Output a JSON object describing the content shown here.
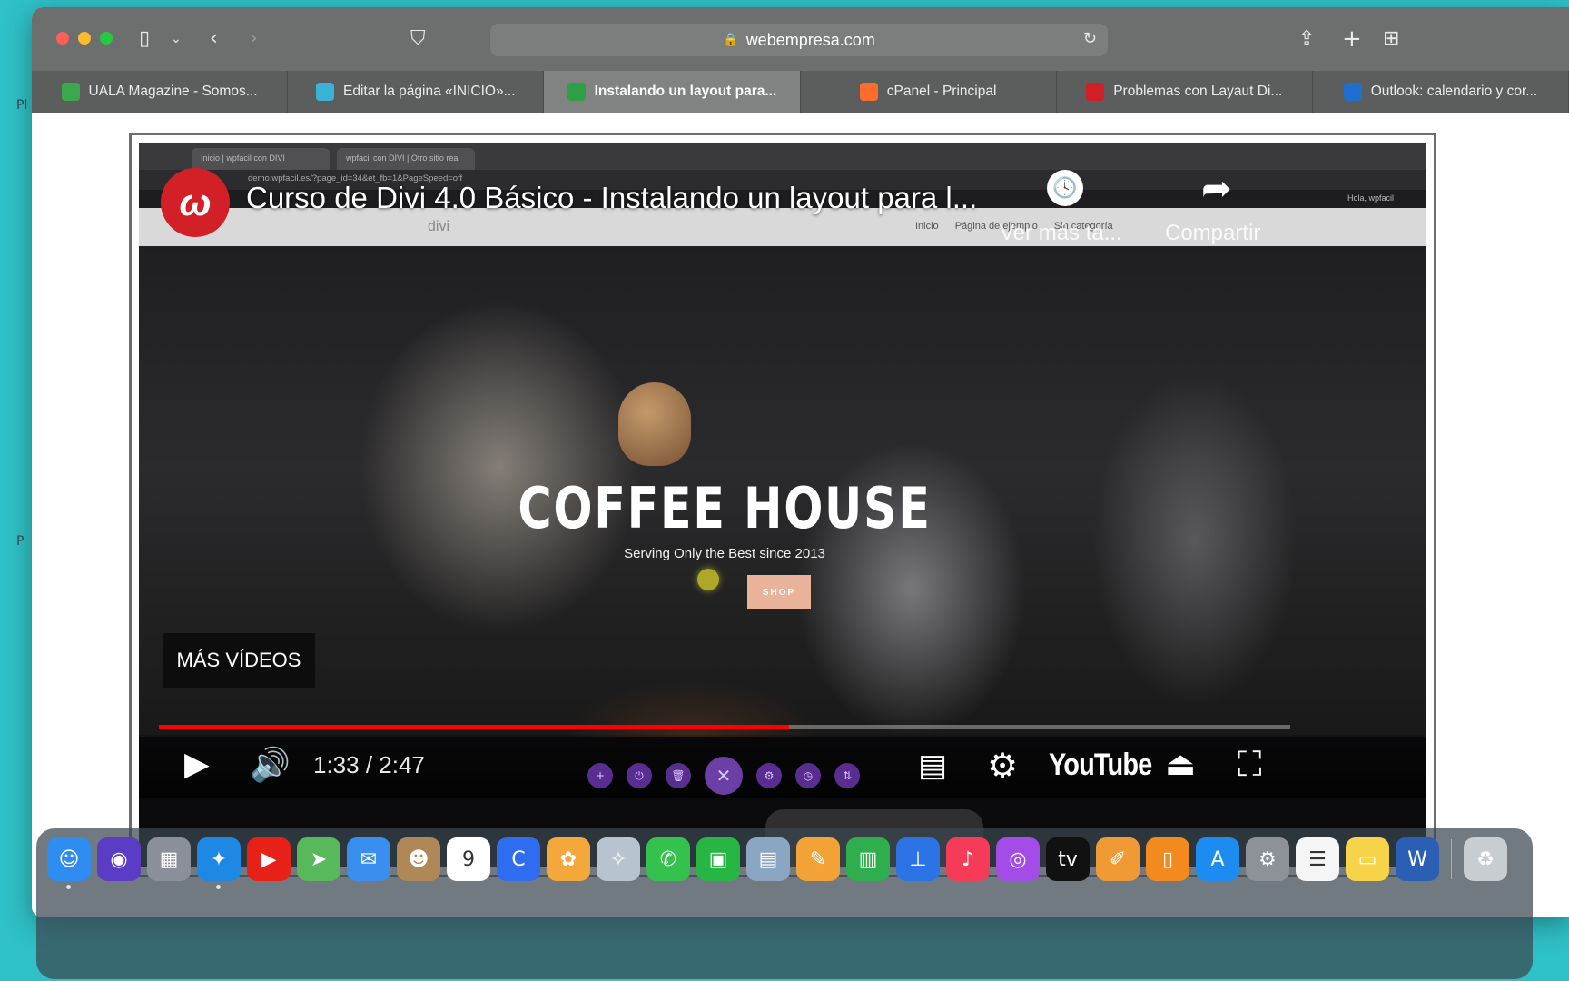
{
  "desktop": {
    "left_text_1": "Pl",
    "left_text_2": "P"
  },
  "browser": {
    "url": "webempresa.com",
    "tabs": [
      {
        "label": "UALA Magazine - Somos...",
        "icon": "uala-favicon",
        "color": "#3aa84b",
        "active": false
      },
      {
        "label": "Editar la página «INICIO»...",
        "icon": "divi-edit-favicon",
        "color": "#3bb3d6",
        "active": false
      },
      {
        "label": "Instalando un layout para...",
        "icon": "webempresa-favicon",
        "color": "#2e9f45",
        "active": true
      },
      {
        "label": "cPanel - Principal",
        "icon": "cpanel-favicon",
        "color": "#ff6c2c",
        "active": false
      },
      {
        "label": "Problemas con Layaut Di...",
        "icon": "webempresa-red-favicon",
        "color": "#d31f26",
        "active": false
      },
      {
        "label": "Outlook: calendario y cor...",
        "icon": "outlook-favicon",
        "color": "#1f6fd1",
        "active": false
      }
    ]
  },
  "recorded_browser": {
    "tab1": "Inicio | wpfacil con DIVI",
    "tab2": "wpfacil con DIVI | Otro sitio real",
    "url": "demo.wpfacil.es/?page_id=34&et_fb=1&PageSpeed=off",
    "admin_user": "Hola, wpfacil",
    "site_logo": "divi",
    "nav": [
      "Inicio",
      "Página de ejemplo",
      "Sin categoría"
    ]
  },
  "hero": {
    "title": "COFFEE HOUSE",
    "subtitle": "Serving Only the Best since 2013",
    "button": "SHOP"
  },
  "youtube": {
    "video_title": "Curso de Divi 4.0 Básico - Instalando un layout para l...",
    "channel": "webempresa",
    "watch_later_label": "Ver más ta...",
    "share_label": "Compartir",
    "more_videos": "MÁS VÍDEOS",
    "current_time": "1:33",
    "duration": "2:47",
    "time_display": "1:33 / 2:47",
    "progress_fraction": 0.557,
    "logo": "YouTube"
  },
  "dock": [
    {
      "name": "finder-icon",
      "glyph": "☺",
      "color": "#2f8cf0",
      "running": true
    },
    {
      "name": "siri-icon",
      "glyph": "◉",
      "color": "#5b3cc4",
      "running": false
    },
    {
      "name": "launchpad-icon",
      "glyph": "▦",
      "color": "#8a8f99",
      "running": false
    },
    {
      "name": "safari-icon",
      "glyph": "✦",
      "color": "#1e88e5",
      "running": true
    },
    {
      "name": "youtube-app-icon",
      "glyph": "▶",
      "color": "#e62117",
      "running": false
    },
    {
      "name": "maps-icon",
      "glyph": "➤",
      "color": "#58b85c",
      "running": false
    },
    {
      "name": "mail-icon",
      "glyph": "✉",
      "color": "#3a8ef0",
      "running": false
    },
    {
      "name": "contacts-icon",
      "glyph": "☻",
      "color": "#b08858",
      "running": false
    },
    {
      "name": "calendar-icon",
      "glyph": "9",
      "color": "#ffffff",
      "running": false
    },
    {
      "name": "cursive-app-icon",
      "glyph": "C",
      "color": "#2f6df0",
      "running": false
    },
    {
      "name": "photos-icon",
      "glyph": "✿",
      "color": "#f4a73b",
      "running": false
    },
    {
      "name": "instruments-icon",
      "glyph": "✧",
      "color": "#b7c4cf",
      "running": false
    },
    {
      "name": "messages-icon",
      "glyph": "✆",
      "color": "#33c24d",
      "running": false
    },
    {
      "name": "facetime-icon",
      "glyph": "▣",
      "color": "#27b543",
      "running": false
    },
    {
      "name": "preview-icon",
      "glyph": "▤",
      "color": "#8aa6c3",
      "running": false
    },
    {
      "name": "pages-icon",
      "glyph": "✎",
      "color": "#f3a236",
      "running": false
    },
    {
      "name": "numbers-icon",
      "glyph": "▥",
      "color": "#2fae4e",
      "running": false
    },
    {
      "name": "keynote-icon",
      "glyph": "⊥",
      "color": "#2c73e5",
      "running": false
    },
    {
      "name": "music-icon",
      "glyph": "♪",
      "color": "#f53b57",
      "running": false
    },
    {
      "name": "podcasts-icon",
      "glyph": "◎",
      "color": "#a44ce8",
      "running": false
    },
    {
      "name": "apple-tv-icon",
      "glyph": "tv",
      "color": "#111111",
      "running": false
    },
    {
      "name": "pages-alt-icon",
      "glyph": "✐",
      "color": "#f09a35",
      "running": false
    },
    {
      "name": "books-icon",
      "glyph": "▯",
      "color": "#f28a1e",
      "running": false
    },
    {
      "name": "app-store-icon",
      "glyph": "A",
      "color": "#1d8cf0",
      "running": false
    },
    {
      "name": "system-preferences-icon",
      "glyph": "⚙",
      "color": "#8d9198",
      "running": false
    },
    {
      "name": "reminders-icon",
      "glyph": "☰",
      "color": "#f5f5f5",
      "running": false
    },
    {
      "name": "notes-icon",
      "glyph": "▭",
      "color": "#f7d34a",
      "running": false
    },
    {
      "name": "word-icon",
      "glyph": "W",
      "color": "#2b5fb4",
      "running": false
    },
    {
      "name": "trash-icon",
      "glyph": "♻",
      "color": "#c8cdd2",
      "running": false
    }
  ]
}
